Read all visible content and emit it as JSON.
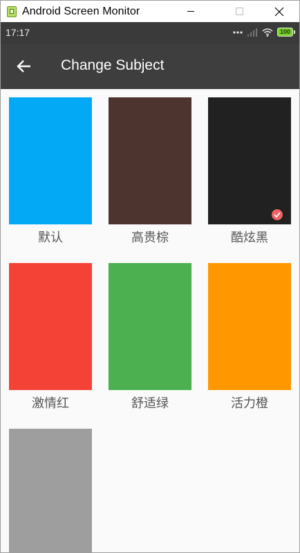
{
  "window": {
    "title": "Android Screen Monitor"
  },
  "status_bar": {
    "time": "17:17",
    "battery": "100"
  },
  "toolbar": {
    "title": "Change Subject",
    "back_icon": "arrow-left-icon"
  },
  "themes": [
    {
      "label": "默认",
      "color": "#03a9f4",
      "selected": false
    },
    {
      "label": "高贵棕",
      "color": "#4e342e",
      "selected": false
    },
    {
      "label": "酷炫黑",
      "color": "#212121",
      "selected": true
    },
    {
      "label": "激情红",
      "color": "#f44336",
      "selected": false
    },
    {
      "label": "舒适绿",
      "color": "#4caf50",
      "selected": false
    },
    {
      "label": "活力橙",
      "color": "#ff9800",
      "selected": false
    },
    {
      "label": "",
      "color": "#9e9e9e",
      "selected": false
    }
  ],
  "colors": {
    "toolbar": "#3e3e3e",
    "status_bar": "#3a3a3a",
    "background": "#fafafa",
    "check_badge": "#ef6262"
  }
}
